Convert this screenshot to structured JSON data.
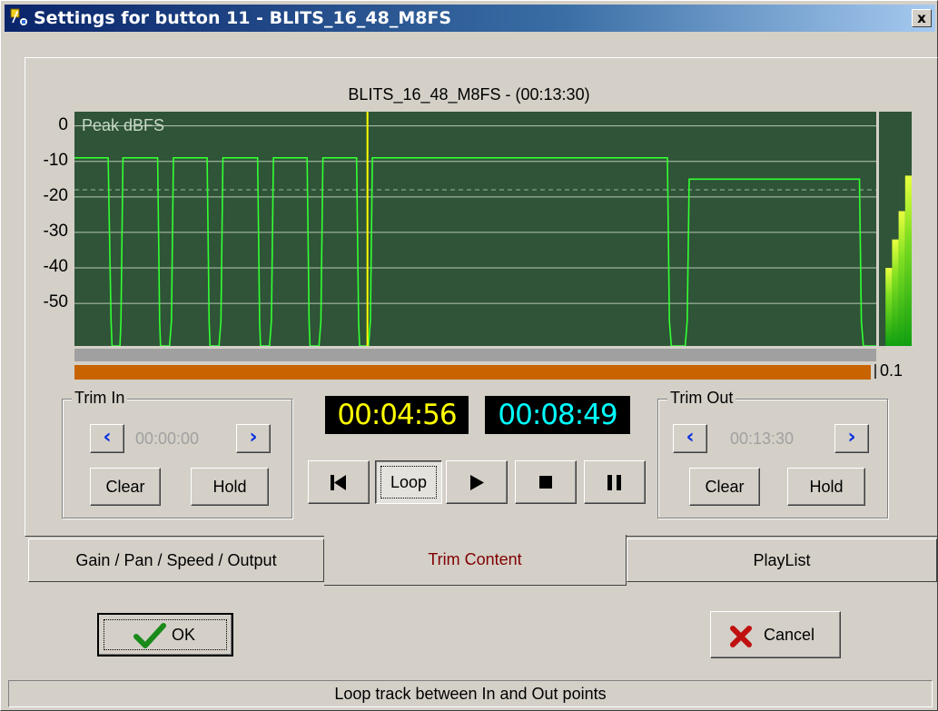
{
  "window": {
    "title": "Settings for button 11 - BLITS_16_48_M8FS",
    "close_label": "x"
  },
  "track": {
    "title": "BLITS_16_48_M8FS - (00:13:30)",
    "peak_label": "Peak dBFS",
    "zoom": "0.1"
  },
  "chart_data": {
    "type": "line",
    "ylabel": "Peak dBFS",
    "y_ticks": [
      "0",
      "-10",
      "-20",
      "-30",
      "-40",
      "-50"
    ],
    "y_tick_values": [
      0,
      -10,
      -20,
      -30,
      -40,
      -50
    ],
    "ylim": [
      -62,
      4
    ],
    "xlim": [
      0,
      810
    ],
    "x_units": "seconds",
    "grid": true,
    "dashed_reference_db": -18,
    "playhead_seconds": 296,
    "series": [
      {
        "color": "#33ff33",
        "points": [
          [
            0,
            -9
          ],
          [
            34,
            -9
          ],
          [
            37,
            -55
          ],
          [
            38,
            -62
          ],
          [
            46,
            -62
          ],
          [
            47,
            -55
          ],
          [
            49,
            -9
          ],
          [
            84,
            -9
          ],
          [
            86,
            -55
          ],
          [
            87,
            -62
          ],
          [
            96,
            -62
          ],
          [
            98,
            -55
          ],
          [
            100,
            -9
          ],
          [
            134,
            -9
          ],
          [
            136,
            -55
          ],
          [
            137,
            -62
          ],
          [
            146,
            -62
          ],
          [
            148,
            -55
          ],
          [
            150,
            -9
          ],
          [
            185,
            -9
          ],
          [
            187,
            -55
          ],
          [
            188,
            -62
          ],
          [
            197,
            -62
          ],
          [
            199,
            -55
          ],
          [
            201,
            -9
          ],
          [
            235,
            -9
          ],
          [
            237,
            -55
          ],
          [
            238,
            -62
          ],
          [
            247,
            -62
          ],
          [
            249,
            -55
          ],
          [
            251,
            -9
          ],
          [
            285,
            -9
          ],
          [
            287,
            -55
          ],
          [
            288,
            -62
          ],
          [
            297,
            -62
          ],
          [
            299,
            -55
          ],
          [
            301,
            -9
          ],
          [
            599,
            -9
          ],
          [
            601,
            -55
          ],
          [
            603,
            -62
          ],
          [
            617,
            -62
          ],
          [
            619,
            -55
          ],
          [
            621,
            -15
          ],
          [
            793,
            -15
          ],
          [
            795,
            -55
          ],
          [
            797,
            -62
          ],
          [
            810,
            -62
          ]
        ]
      }
    ]
  },
  "meter": {
    "levels_db": [
      -14,
      -24,
      -32,
      -40
    ]
  },
  "trim_in": {
    "title": "Trim In",
    "time": "00:00:00",
    "clear": "Clear",
    "hold": "Hold"
  },
  "trim_out": {
    "title": "Trim Out",
    "time": "00:13:30",
    "clear": "Clear",
    "hold": "Hold"
  },
  "counters": {
    "position": "00:04:56",
    "remaining": "00:08:49",
    "position_color": "#ffff00",
    "remaining_color": "#00ffff"
  },
  "transport": {
    "loop": "Loop"
  },
  "tabs": [
    {
      "label": "Gain / Pan / Speed / Output"
    },
    {
      "label": "Trim Content"
    },
    {
      "label": "PlayList"
    }
  ],
  "dialog": {
    "ok": "OK",
    "cancel": "Cancel"
  },
  "status": "Loop track between In and Out points"
}
